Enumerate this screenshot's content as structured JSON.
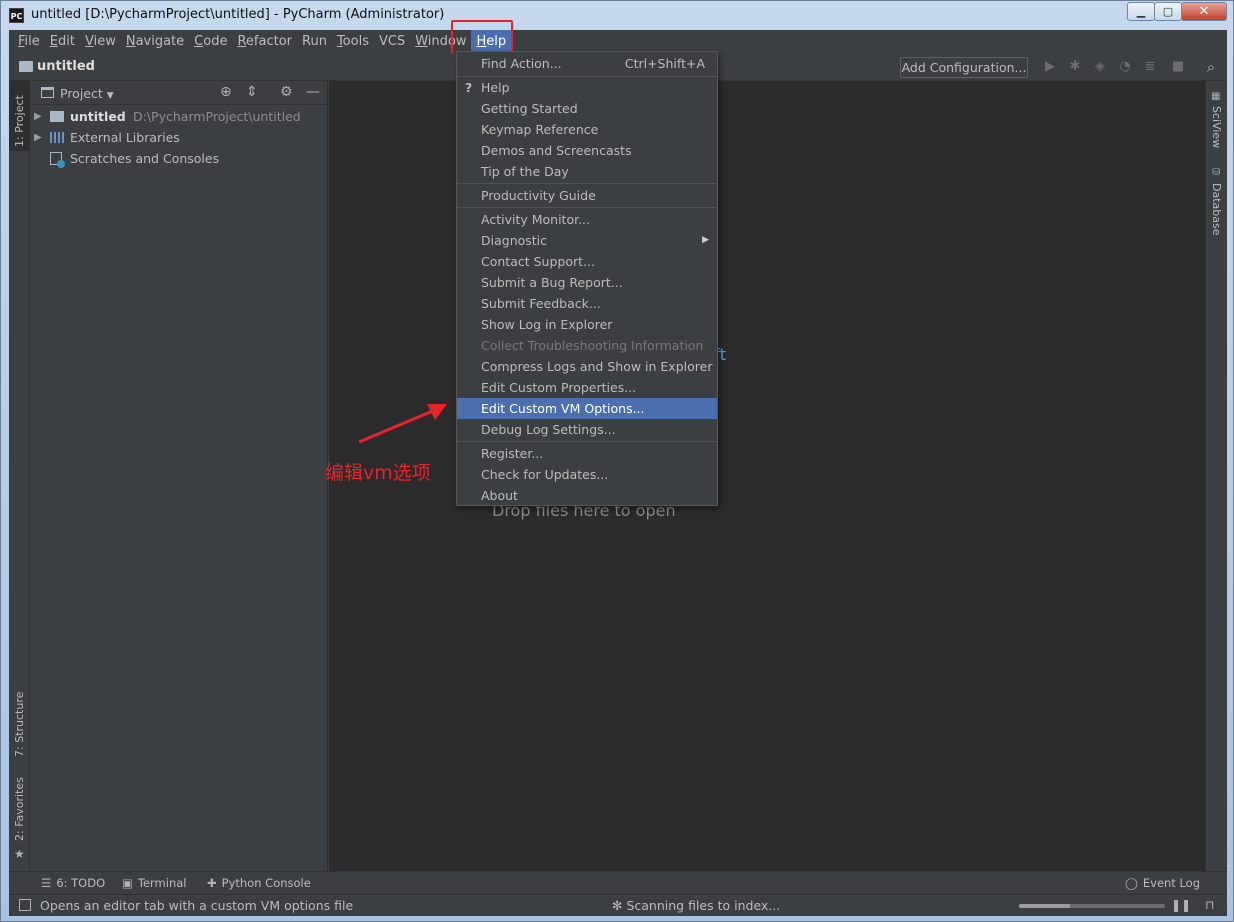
{
  "window": {
    "app_icon_text": "PC",
    "title": "untitled [D:\\PycharmProject\\untitled] - PyCharm (Administrator)"
  },
  "menubar": [
    {
      "label": "File",
      "u": "F",
      "rest": "ile"
    },
    {
      "label": "Edit",
      "u": "E",
      "rest": "dit"
    },
    {
      "label": "View",
      "u": "V",
      "rest": "iew"
    },
    {
      "label": "Navigate",
      "u": "N",
      "rest": "avigate"
    },
    {
      "label": "Code",
      "u": "C",
      "rest": "ode"
    },
    {
      "label": "Refactor",
      "u": "R",
      "rest": "efactor"
    },
    {
      "label": "Run",
      "u": "",
      "rest": "Run"
    },
    {
      "label": "Tools",
      "u": "T",
      "rest": "ools"
    },
    {
      "label": "VCS",
      "u": "",
      "rest": "VCS"
    },
    {
      "label": "Window",
      "u": "W",
      "rest": "indow"
    },
    {
      "label": "Help",
      "u": "H",
      "rest": "elp"
    }
  ],
  "navbar": {
    "title": "untitled",
    "add_configuration": "Add Configuration..."
  },
  "left_strip": {
    "project": "1: Project",
    "structure": "7: Structure",
    "favorites": "2: Favorites"
  },
  "right_strip": {
    "sciview": "SciView",
    "database": "Database"
  },
  "project_panel": {
    "title": "Project",
    "tree": {
      "root_name": "untitled",
      "root_path": "D:\\PycharmProject\\untitled",
      "external_libraries": "External Libraries",
      "scratches": "Scratches and Consoles"
    }
  },
  "editor": {
    "shift_hint": "ift",
    "drop_hint": "Drop files here to open"
  },
  "help_menu": {
    "find_action": "Find Action...",
    "find_action_shortcut": "Ctrl+Shift+A",
    "help": "Help",
    "getting_started": "Getting Started",
    "keymap_reference": "Keymap Reference",
    "demos": "Demos and Screencasts",
    "tip_of_day": "Tip of the Day",
    "productivity_guide": "Productivity Guide",
    "activity_monitor": "Activity Monitor...",
    "diagnostic": "Diagnostic",
    "contact_support": "Contact Support...",
    "submit_bug": "Submit a Bug Report...",
    "submit_feedback": "Submit Feedback...",
    "show_log": "Show Log in Explorer",
    "collect_troubleshooting": "Collect Troubleshooting Information",
    "compress_logs": "Compress Logs and Show in Explorer",
    "edit_custom_properties": "Edit Custom Properties...",
    "edit_custom_vm": "Edit Custom VM Options...",
    "debug_log": "Debug Log Settings...",
    "register": "Register...",
    "check_updates": "Check for Updates...",
    "about": "About"
  },
  "annotation": {
    "label": "编辑vm选项",
    "color": "#e8232b"
  },
  "bottom_tools": {
    "todo": "6: TODO",
    "terminal": "Terminal",
    "python_console": "Python Console",
    "event_log": "Event Log"
  },
  "statusbar": {
    "message": "Opens an editor tab with a custom VM options file",
    "scanning": "Scanning files to index..."
  },
  "colors": {
    "accent": "#4b6eaf",
    "editor_bg": "#2b2b2b",
    "panel_bg": "#3c3f41"
  }
}
